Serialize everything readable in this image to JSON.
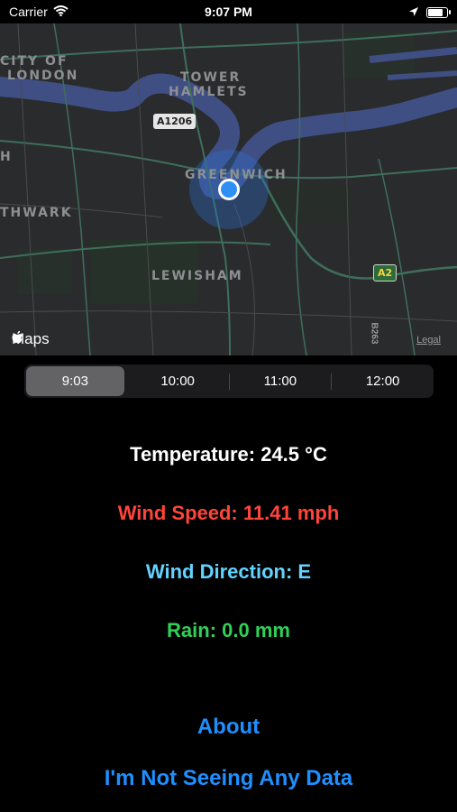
{
  "status_bar": {
    "carrier": "Carrier",
    "time": "9:07 PM",
    "battery_level": 0.9
  },
  "map": {
    "labels": {
      "city_line1": "CITY OF",
      "city_line2": "LONDON",
      "tower_line1": "TOWER",
      "tower_line2": "HAMLETS",
      "greenwich": "GREENWICH",
      "southwark": "THWARK",
      "lewisham": "LEWISHAM",
      "left_edge": "H"
    },
    "roads": {
      "a1206": "A1206",
      "a2": "A2",
      "b263": "B263"
    },
    "brand": "Maps",
    "legal": "Legal"
  },
  "segmented_control": {
    "options": [
      "9:03",
      "10:00",
      "11:00",
      "12:00"
    ],
    "selected": "9:03"
  },
  "weather": {
    "temperature": "Temperature: 24.5 °C",
    "wind_speed": "Wind Speed: 11.41 mph",
    "wind_direction": "Wind Direction: E",
    "rain": "Rain: 0.0 mm"
  },
  "links": {
    "about": "About",
    "no_data": "I'm Not Seeing Any Data"
  },
  "colors": {
    "wind_speed": "#ff453a",
    "wind_direction": "#64d2ff",
    "rain": "#30d158",
    "link": "#1f8fff",
    "location_dot": "#2f8ff5"
  }
}
